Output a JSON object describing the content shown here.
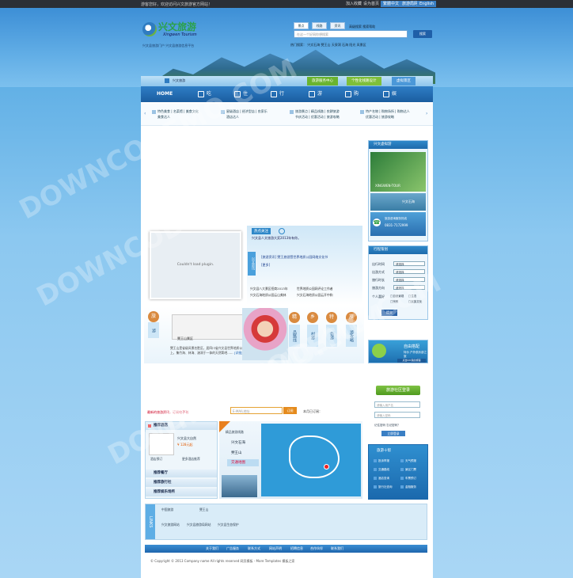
{
  "topbar": {
    "welcome": "游客您好，欢迎访问兴文旅游官方网站！",
    "links": [
      "加入收藏",
      "设为首页",
      "繁體中文",
      "旅游局网",
      "English"
    ]
  },
  "header": {
    "logo_text": "兴文旅游",
    "logo_sub": "Xingwen Tourism",
    "tagline": "兴文县旅游门户   兴文县旅游信息平台",
    "search_tabs": [
      "景点",
      "线路",
      "资讯"
    ],
    "search_extra": "高级搜索  搜索帮助",
    "search_placeholder": "在这一个好网你想搜索",
    "search_button": "搜索",
    "hot_words": "热门搜索：  兴文石海    僰王山    天泉洞    石海    阳光    风景区"
  },
  "subnav": {
    "location": "兴文旅游",
    "tabs": [
      "旅游服务中心",
      "个性化线路设计",
      "虚拟景区"
    ]
  },
  "mainnav": {
    "items": [
      "HOME",
      "吃",
      "住",
      "行",
      "游",
      "购",
      "娱"
    ]
  },
  "categories": [
    {
      "line1": "特色美食 | 名菜馆 | 美食文化",
      "line2": "美食达人"
    },
    {
      "line1": "星级酒店 | 经济型店 | 农家乐",
      "line2": "酒店达人"
    },
    {
      "line1": "旅游景点 | 精品线路 | 农耕旅游",
      "line2": "节庆活动 | 优惠活动 | 旅游攻略"
    },
    {
      "line1": "特产名物 | 购物场所 | 购物达人",
      "line2": "优惠活动 | 旅游攻略"
    }
  ],
  "hot": {
    "title": "热点关注",
    "line": "兴文县人文旅游大奖2013年有你。",
    "flash_text": "Couldn't load plugin.",
    "side_label": "兴文资讯",
    "main_news": "[旅游资讯]   僰王旅游暨世界地质公园网络文化节",
    "main_sub": "[更多]",
    "news": [
      "兴文县八大景区招商2013年",
      "世界地质公园网评论工作者",
      "兴文石海地质公园云山美林",
      "兴文石海地质公园云开中和"
    ]
  },
  "travel": {
    "left_chars": [
      "旅",
      "游"
    ],
    "right_circles": [
      "精",
      "乡",
      "特",
      "旅"
    ],
    "right_vertical": [
      "品路线",
      "村游",
      "色游",
      "游攻略"
    ],
    "photo_caption": "僰王山景区",
    "desc": "僰王山是省级风景名胜区，居四川省兴文县世界地质公园西部，森林覆盖率90%以上，集竹海、林海、溶洞于一体的天然氧吧……",
    "more": "[详细]"
  },
  "subscribe": {
    "label": "最新的旅游资讯，订阅电子刊",
    "input": "E-MAIL地址",
    "button": "订阅",
    "count": "本月已订阅："
  },
  "hotels": {
    "rows": [
      "推荐酒店",
      "推荐餐厅",
      "推荐旅行社",
      "推荐娱乐场所"
    ],
    "hotel_name": "兴文县大自然",
    "hotel_price": "¥ 128元起",
    "hotel_links": [
      "酒店预订",
      "更多酒店推荐"
    ]
  },
  "map": {
    "tabs_label": "精品旅游线路",
    "items": [
      "兴文石海",
      "僰王山",
      "交通地图"
    ]
  },
  "sidebar": {
    "virtual_title": "兴文虚拟游",
    "virtual_img_label": "XINGWEN-TOUR",
    "stone_sea": "兴文石海",
    "hotline_label": "旅游咨询服务热线",
    "hotline": "0831-7172999",
    "planner_title": "行程策划",
    "planner_rows": [
      {
        "label": "出行时间",
        "value": "请选择"
      },
      {
        "label": "出游方式",
        "value": "请选择"
      },
      {
        "label": "旅行时长",
        "value": "请选择"
      },
      {
        "label": "旅游方向",
        "value": "请选择"
      }
    ],
    "prefs_label": "个人喜好",
    "prefs": [
      "自然景观",
      "生态",
      "宗教",
      "民族文化"
    ],
    "plan_button": "提交",
    "self_drive_title": "自由搭配",
    "self_drive_sub": "特价  户外俱乐部之旅",
    "self_drive_btn": "点击DIY我的旅程",
    "community_button": "旅游社区登录",
    "login_user": "请输入用户名",
    "login_pass": "请输入密码",
    "remember": "记住密码  忘记密码？",
    "login_btn": "立即登录",
    "service_title": "旅游十帮",
    "services": [
      "投诉举报",
      "天气预报",
      "交通路线",
      "景区门票",
      "酒店查询",
      "车票预订",
      "旅行社查询",
      "金融服务"
    ]
  },
  "links": {
    "label": "LINKS",
    "logos": [
      "中国旅游",
      "僰王山"
    ],
    "texts": [
      "兴文旅游网站",
      "兴文县旅游局网站",
      "兴文县生态保护"
    ]
  },
  "footer": {
    "nav": [
      "关于我们",
      "广告服务",
      "联系方式",
      "网站声明",
      "招聘信息",
      "合作伙伴",
      "联系我们"
    ],
    "copyright": "© Copyright © 2013 Company name All rights reserved  网页模板 - More Templates  模板之家"
  },
  "watermark": "DOWNCODEMO.COM"
}
